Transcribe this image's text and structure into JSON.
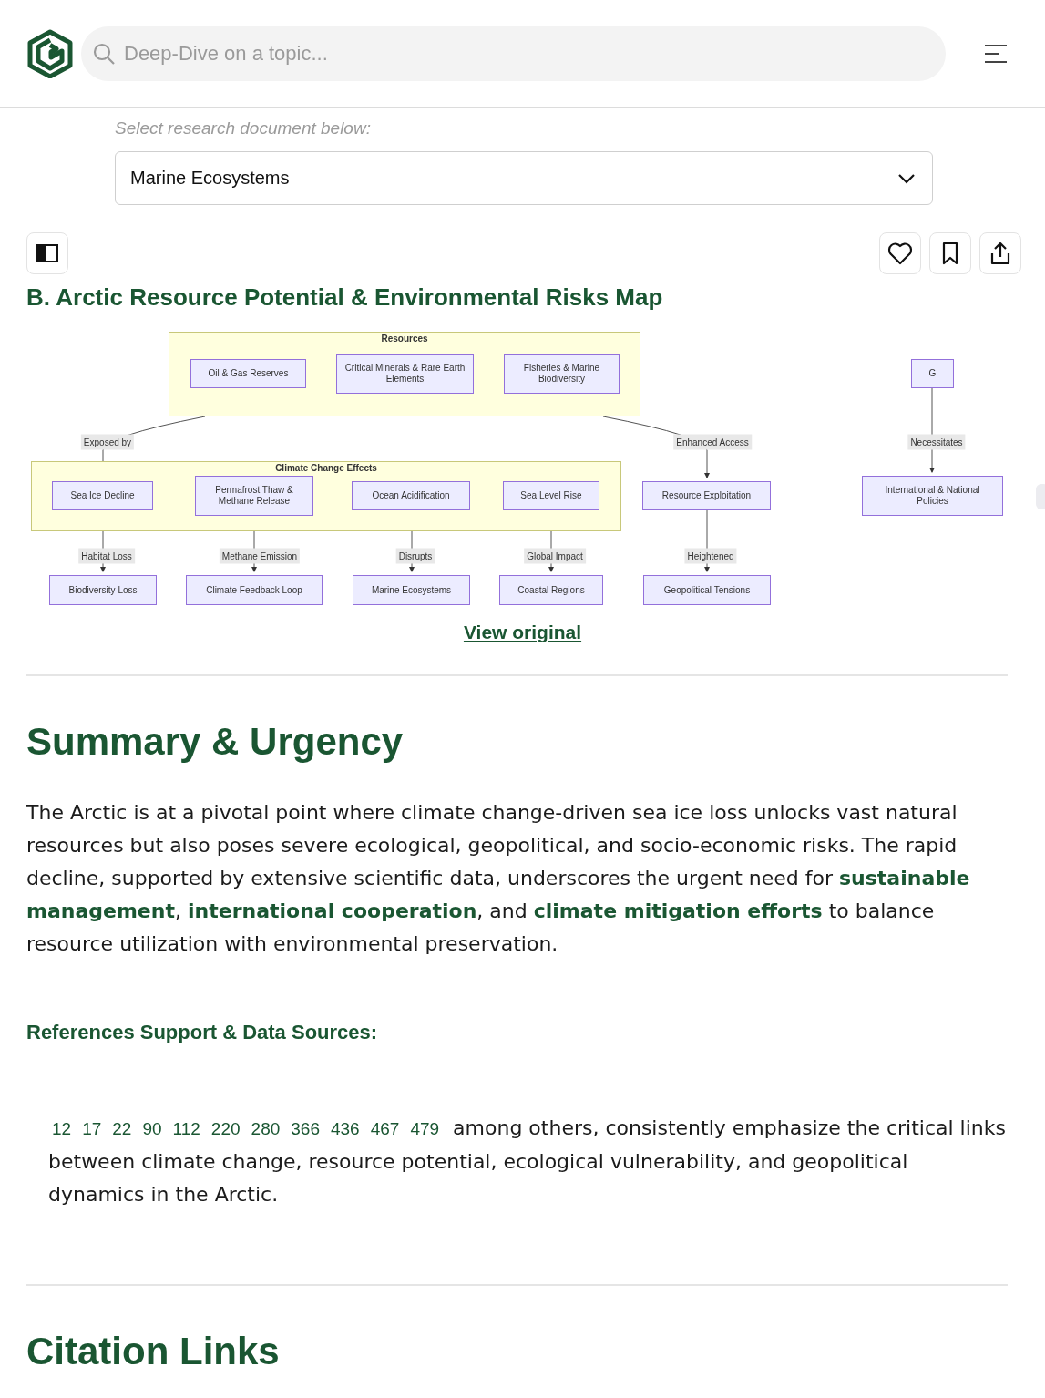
{
  "search": {
    "placeholder": "Deep-Dive on a topic..."
  },
  "document_select": {
    "label": "Select research document below:",
    "value": "Marine Ecosystems"
  },
  "section_title": "B. Arctic Resource Potential & Environmental Risks Map",
  "diagram": {
    "groups": [
      {
        "title": "Resources"
      },
      {
        "title": "Climate Change Effects"
      }
    ],
    "nodes": [
      {
        "label": "Oil & Gas Reserves"
      },
      {
        "label": "Critical Minerals & Rare Earth Elements"
      },
      {
        "label": "Fisheries & Marine Biodiversity"
      },
      {
        "label": "Sea Ice Decline"
      },
      {
        "label": "Permafrost Thaw & Methane Release"
      },
      {
        "label": "Ocean Acidification"
      },
      {
        "label": "Sea Level Rise"
      },
      {
        "label": "Resource Exploitation"
      },
      {
        "label": "G"
      },
      {
        "label": "International & National Policies"
      },
      {
        "label": "Biodiversity Loss"
      },
      {
        "label": "Climate Feedback Loop"
      },
      {
        "label": "Marine Ecosystems"
      },
      {
        "label": "Coastal Regions"
      },
      {
        "label": "Geopolitical Tensions"
      }
    ],
    "edges": [
      {
        "label": "Exposed by"
      },
      {
        "label": "Enhanced Access"
      },
      {
        "label": "Necessitates"
      },
      {
        "label": "Habitat Loss"
      },
      {
        "label": "Methane Emission"
      },
      {
        "label": "Disrupts"
      },
      {
        "label": "Global Impact"
      },
      {
        "label": "Heightened"
      }
    ]
  },
  "view_original": "View original",
  "summary": {
    "heading": "Summary & Urgency",
    "text": "The Arctic is at a pivotal point where climate change-driven sea ice loss unlocks vast natural resources but also poses severe ecological, geopolitical, and socio-economic risks. The rapid decline, supported by extensive scientific data, underscores the urgent need for **sustainable management**, **international cooperation**, and **climate mitigation efforts** to balance resource utilization with environmental preservation."
  },
  "references": {
    "heading": "References Support & Data Sources:",
    "citations": [
      "12",
      "17",
      "22",
      "90",
      "112",
      "220",
      "280",
      "366",
      "436",
      "467",
      "479"
    ],
    "text": "among others, consistently emphasize the critical links between climate change, resource potential, ecological vulnerability, and geopolitical dynamics in the Arctic."
  },
  "next_heading": "Citation Links"
}
